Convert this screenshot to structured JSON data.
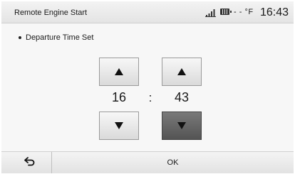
{
  "header": {
    "title": "Remote Engine Start",
    "signal_icon": "signal-strength-icon",
    "battery_icon": "battery-icon",
    "temperature": "- - °F",
    "time": "16:43"
  },
  "content": {
    "label": "Departure Time Set"
  },
  "time_picker": {
    "hours": "16",
    "separator": ":",
    "minutes": "43"
  },
  "footer": {
    "back_icon": "back-arrow-icon",
    "ok_label": "OK"
  }
}
